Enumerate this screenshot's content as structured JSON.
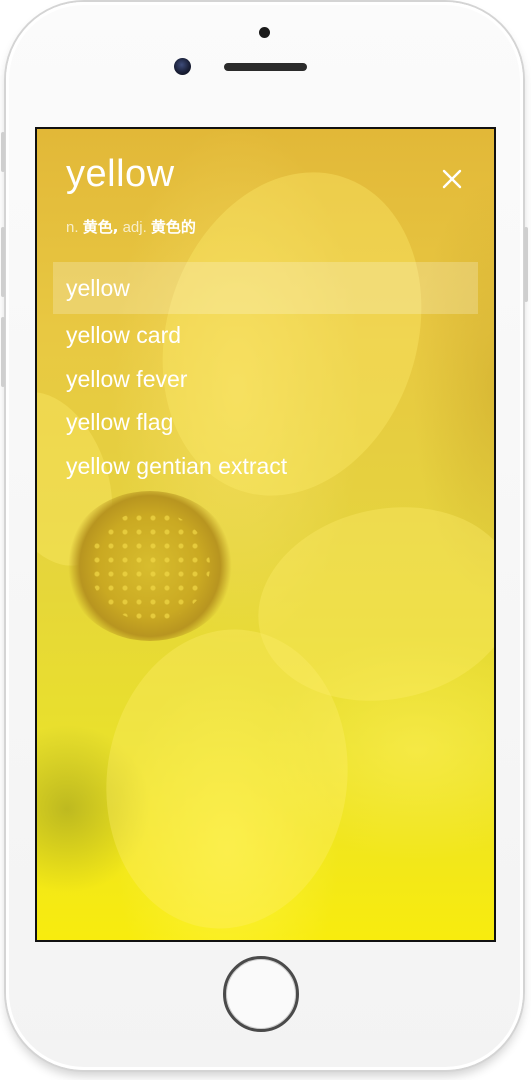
{
  "header": {
    "word": "yellow",
    "close_icon": "close-icon"
  },
  "definition": {
    "pos_noun": "n.",
    "meaning_noun": "黄色,",
    "pos_adj": "adj.",
    "meaning_adj": "黄色的"
  },
  "suggestions": [
    {
      "label": "yellow",
      "selected": true
    },
    {
      "label": "yellow card",
      "selected": false
    },
    {
      "label": "yellow fever",
      "selected": false
    },
    {
      "label": "yellow flag",
      "selected": false
    },
    {
      "label": "yellow gentian extract",
      "selected": false
    }
  ],
  "colors": {
    "text": "#ffffff",
    "background_top": "#e2b838",
    "background_bottom": "#f8ec0e",
    "selected_row": "rgba(255,255,255,0.22)"
  }
}
